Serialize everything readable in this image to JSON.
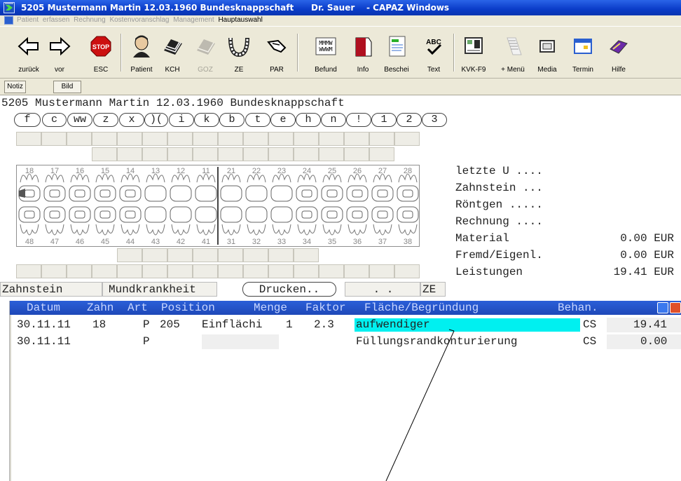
{
  "window": {
    "title": "5205 Mustermann Martin 12.03.1960  Bundesknappschaft",
    "doctor": "Dr. Sauer",
    "app": "- CAPAZ Windows"
  },
  "menu": [
    "Patient",
    "erfassen",
    "Rechnung",
    "Kostenvoranschlag",
    "Management",
    "Hauptauswahl"
  ],
  "toolbar": [
    {
      "label": "zurück",
      "icon": "arrow-left-icon"
    },
    {
      "label": "vor",
      "icon": "arrow-right-icon"
    },
    {
      "label": "ESC",
      "icon": "stop-icon"
    },
    {
      "label": "Patient",
      "icon": "patient-icon"
    },
    {
      "label": "KCH",
      "icon": "kch-icon"
    },
    {
      "label": "GOZ",
      "icon": "goz-icon"
    },
    {
      "label": "ZE",
      "icon": "ze-icon"
    },
    {
      "label": "PAR",
      "icon": "par-icon"
    },
    {
      "label": "Befund",
      "icon": "befund-icon"
    },
    {
      "label": "Info",
      "icon": "info-icon"
    },
    {
      "label": "Bescheid",
      "icon": "bescheid-icon"
    },
    {
      "label": "Text",
      "icon": "text-icon"
    },
    {
      "label": "KVK-F9",
      "icon": "kvk-icon"
    },
    {
      "label": "+ Menü",
      "icon": "menu-icon"
    },
    {
      "label": "Media",
      "icon": "media-icon"
    },
    {
      "label": "Termin",
      "icon": "termin-icon"
    },
    {
      "label": "Hilfe",
      "icon": "hilfe-icon"
    }
  ],
  "toolbar_display": [
    "zurück",
    "vor",
    "ESC",
    "Patient",
    "KCH",
    "GOZ",
    "ZE",
    "PAR",
    "Befund",
    "Info",
    "Beschei",
    "Text",
    "KVK-F9",
    "+ Menü",
    "Media",
    "Termin",
    "Hilfe"
  ],
  "notes": {
    "notiz": "Notiz",
    "bild": "Bild"
  },
  "patient_line": "5205 Mustermann Martin 12.03.1960  Bundesknappschaft",
  "status_pills": [
    "f",
    "c",
    "ww",
    "z",
    "x",
    ")(",
    "i",
    "k",
    "b",
    "t",
    "e",
    "h",
    "n",
    "!",
    "1",
    "2",
    "3"
  ],
  "teeth": {
    "upper": [
      "18",
      "17",
      "16",
      "15",
      "14",
      "13",
      "12",
      "11",
      "21",
      "22",
      "23",
      "24",
      "25",
      "26",
      "27",
      "28"
    ],
    "lower": [
      "48",
      "47",
      "46",
      "45",
      "44",
      "43",
      "42",
      "41",
      "31",
      "32",
      "33",
      "34",
      "35",
      "36",
      "37",
      "38"
    ]
  },
  "summary": {
    "letzte_u": "letzte U ....",
    "zahnstein": "Zahnstein ...",
    "roentgen": "Röntgen .....",
    "rechnung": "Rechnung ....",
    "material_label": "Material",
    "material_value": "0.00 EUR",
    "fremd_label": "Fremd/Eigenl.",
    "fremd_value": "0.00 EUR",
    "leistungen_label": "Leistungen",
    "leistungen_value": "19.41 EUR"
  },
  "footer": {
    "zahnstein": "Zahnstein",
    "mundkrankheit": "Mundkrankheit",
    "drucken": "Drucken..",
    "dots": ".  .",
    "ze": "ZE"
  },
  "table": {
    "headers": [
      "Datum",
      "Zahn",
      "Art",
      "Position",
      "Menge",
      "Faktor",
      "Fläche/Begründung",
      "Behan."
    ],
    "rows": [
      {
        "datum": "30.11.11",
        "zahn": "18",
        "art": "P",
        "position": "205",
        "beschreibung": "Einflächi",
        "menge": "1",
        "faktor": "2.3",
        "begruendung": "aufwendiger",
        "behan": "CS",
        "betrag": "19.41"
      },
      {
        "datum": "30.11.11",
        "zahn": "",
        "art": "P",
        "position": "",
        "beschreibung": "",
        "menge": "",
        "faktor": "",
        "begruendung": "Füllungsrandkonturierung",
        "behan": "CS",
        "betrag": "0.00"
      }
    ]
  },
  "colors": {
    "highlight": "#00f0f0",
    "header": "#2b5fd8",
    "titlebar": "#0a3cc8"
  }
}
